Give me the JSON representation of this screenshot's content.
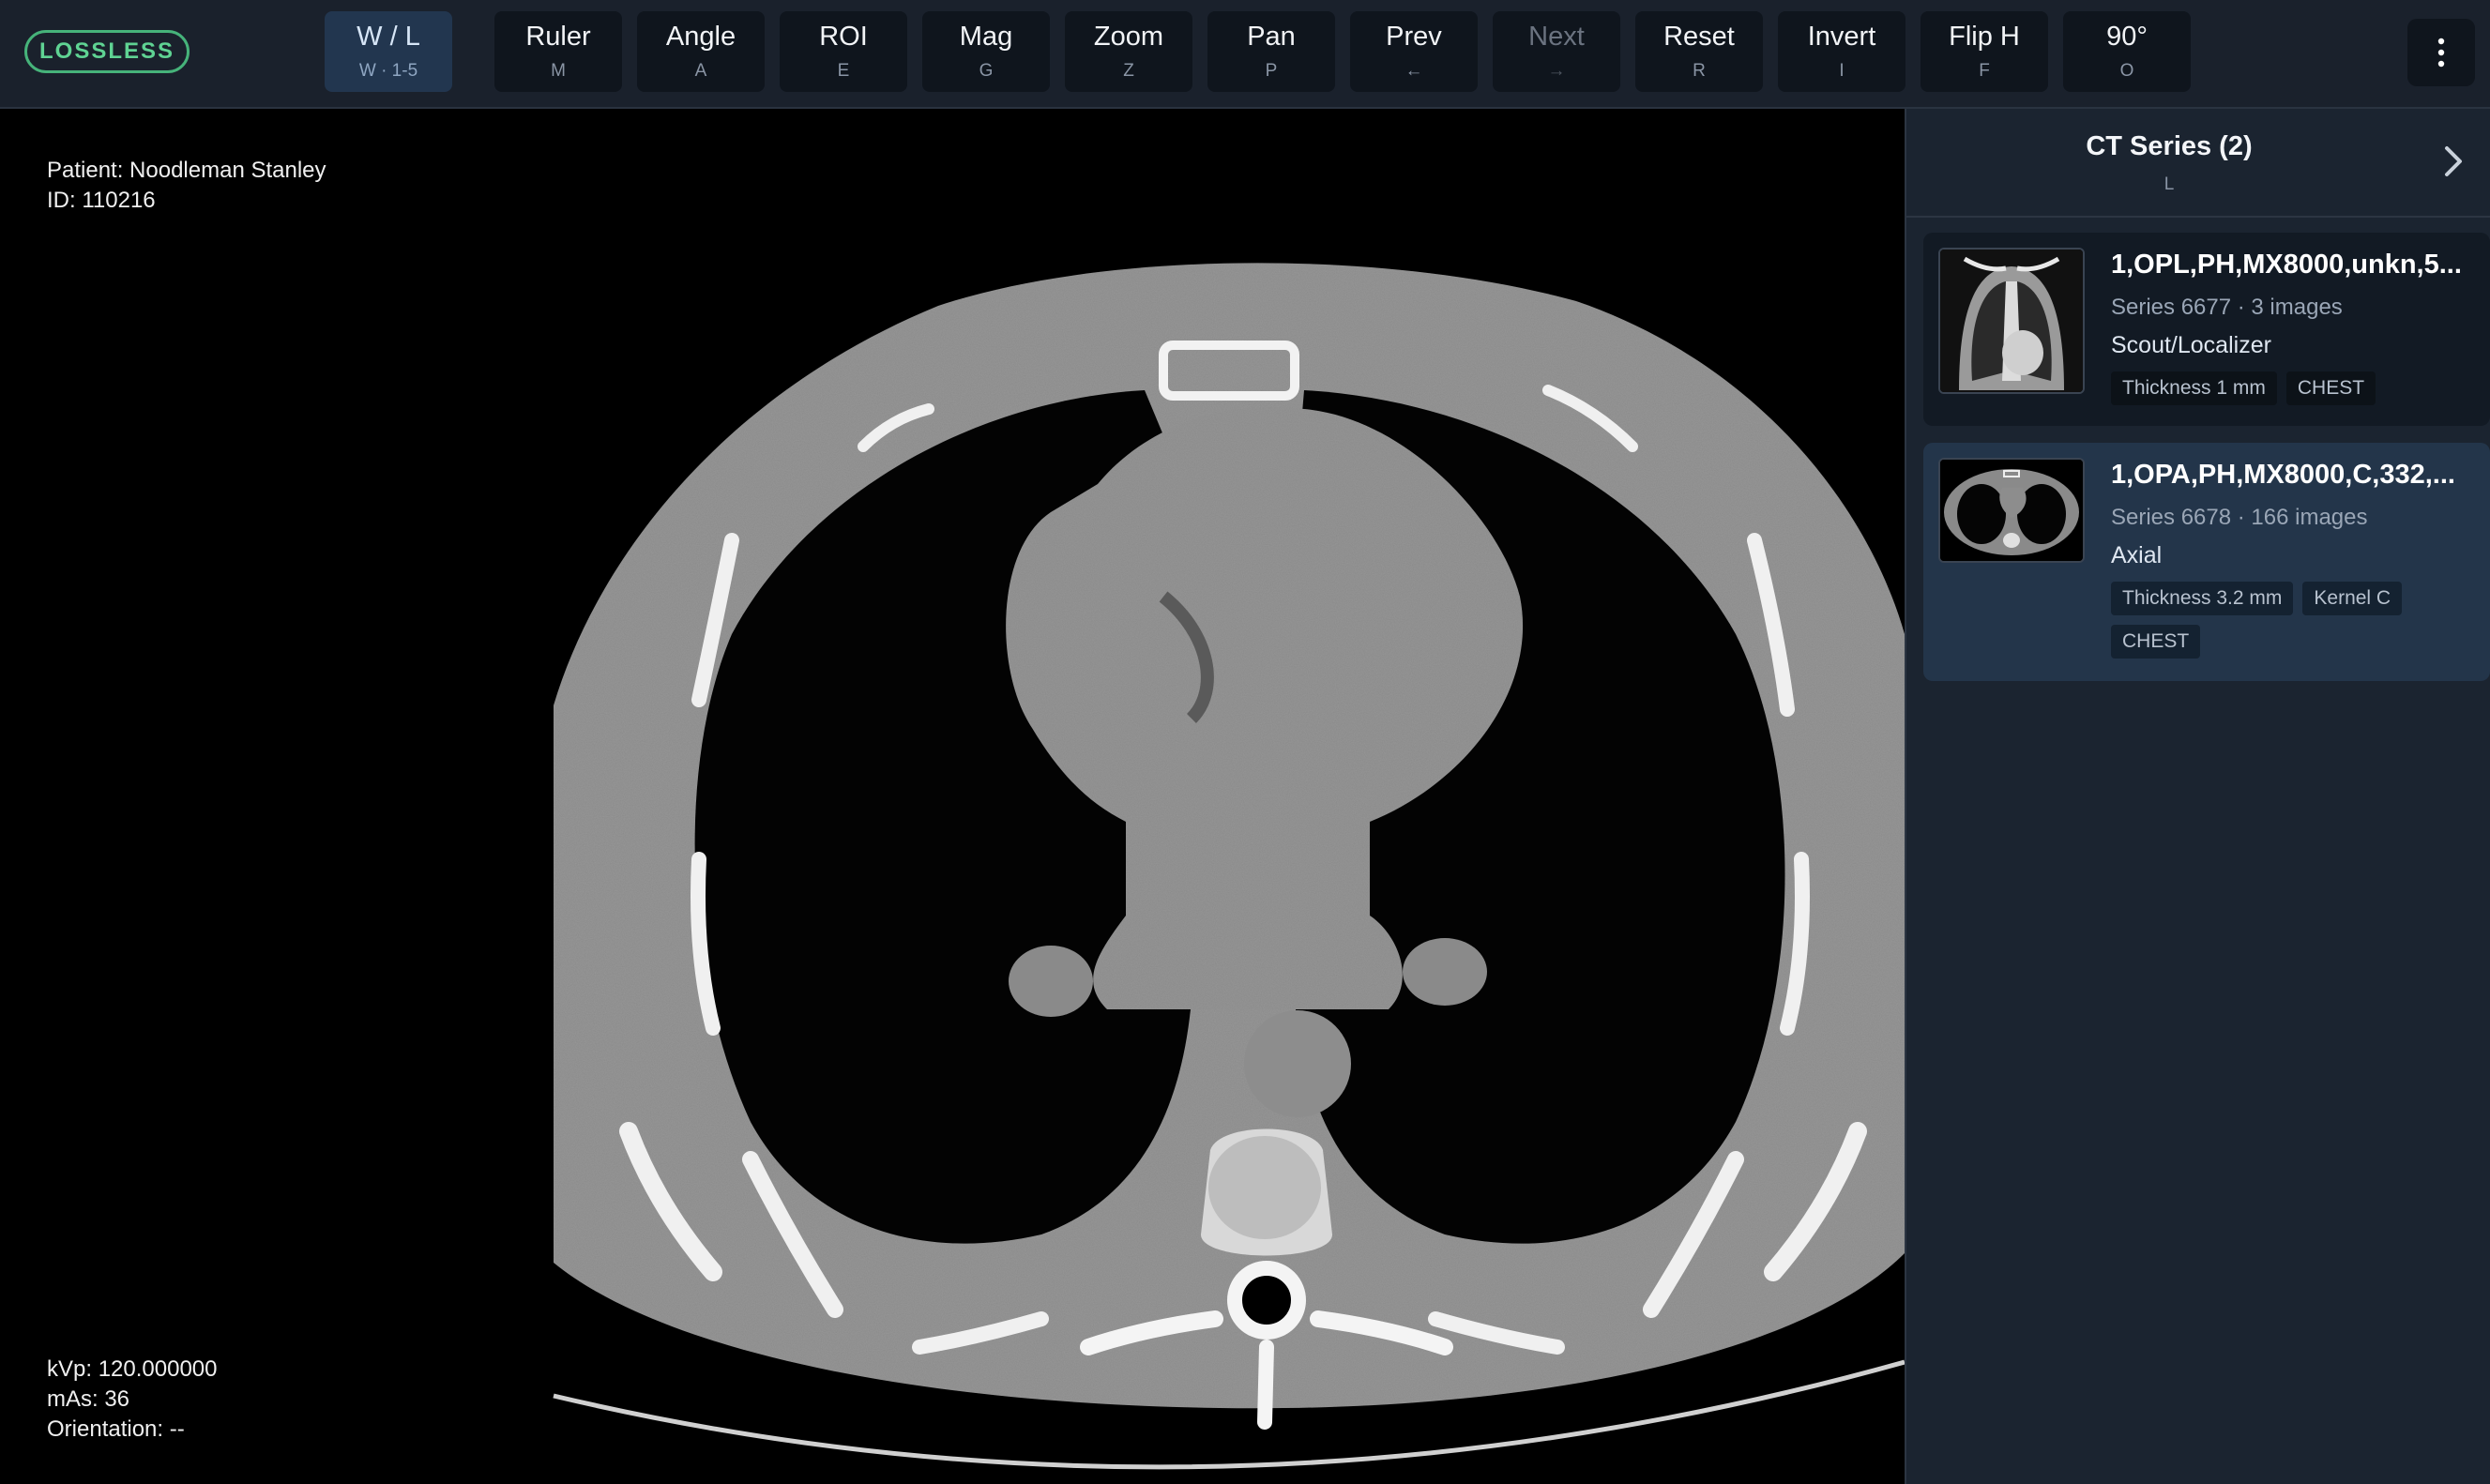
{
  "toolbar": {
    "badge": "LOSSLESS",
    "tools": [
      {
        "label": "W / L",
        "key": "W · 1-5",
        "active": true
      },
      {
        "label": "Ruler",
        "key": "M"
      },
      {
        "label": "Angle",
        "key": "A"
      },
      {
        "label": "ROI",
        "key": "E"
      },
      {
        "label": "Mag",
        "key": "G"
      },
      {
        "label": "Zoom",
        "key": "Z"
      },
      {
        "label": "Pan",
        "key": "P"
      },
      {
        "label": "Prev",
        "key": "←"
      },
      {
        "label": "Next",
        "key": "→",
        "disabled": true
      },
      {
        "label": "Reset",
        "key": "R"
      },
      {
        "label": "Invert",
        "key": "I"
      },
      {
        "label": "Flip H",
        "key": "F"
      },
      {
        "label": "90°",
        "key": "O"
      }
    ],
    "menu_icon": "kebab-menu-icon"
  },
  "viewer": {
    "patient": "Patient: Noodleman Stanley",
    "id": "ID: 110216",
    "kvp": "kVp: 120.000000",
    "mas": "mAs: 36",
    "orientation": "Orientation: --"
  },
  "panel": {
    "title": "CT Series (2)",
    "key": "L",
    "expand_icon": "chevron-right-icon",
    "series": [
      {
        "title": "1,OPL,PH,MX8000,unkn,5...",
        "meta": "Series 6677 · 3 images",
        "type": "Scout/Localizer",
        "tags": [
          "Thickness 1 mm",
          "CHEST"
        ]
      },
      {
        "title": "1,OPA,PH,MX8000,C,332,...",
        "meta": "Series 6678 · 166 images",
        "type": "Axial",
        "tags": [
          "Thickness 3.2 mm",
          "Kernel C",
          "CHEST"
        ]
      }
    ]
  },
  "colors": {
    "accent_green": "#46b37a",
    "toolbar_bg": "#1a212c",
    "panel_bg": "#1b2430",
    "selected_card": "#23354a"
  }
}
